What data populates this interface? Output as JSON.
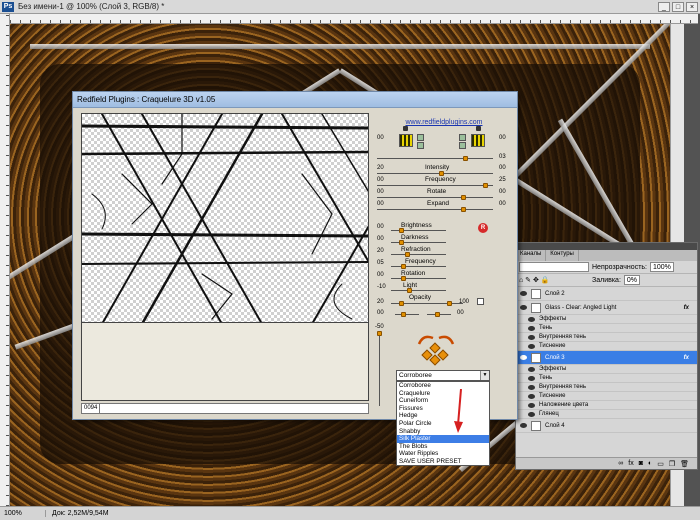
{
  "document": {
    "title": "Без имени-1 @ 100% (Слой 3, RGB/8) *",
    "app_icon": "Ps",
    "window_buttons": [
      "_",
      "□",
      "×"
    ]
  },
  "status": {
    "zoom": "100%",
    "doc_info": "Док: 2,52M/9,54M"
  },
  "plugin": {
    "title": "Redfield Plugins : Craquelure 3D  v1.05",
    "link": "www.redfieldplugins.com",
    "info_box": [
      "0094"
    ],
    "top_values": {
      "left": "00",
      "right": "00",
      "right2": "03"
    },
    "main_sliders": [
      {
        "label": "Intensity",
        "left": "20",
        "right": "00",
        "level": 0.55
      },
      {
        "label": "Frequency",
        "left": "00",
        "right": "25",
        "level": 0.95
      },
      {
        "label": "Rotate",
        "left": "00",
        "right": "00",
        "level": 0.75
      },
      {
        "label": "Expand",
        "left": "00",
        "right": "00",
        "level": 0.75
      }
    ],
    "light_sliders": [
      {
        "label": "Brightness",
        "value": "00"
      },
      {
        "label": "Darkness",
        "value": "00"
      },
      {
        "label": "Refraction",
        "value": "20"
      },
      {
        "label": "Frequency",
        "value": "05"
      },
      {
        "label": "Rotation",
        "value": "00"
      },
      {
        "label": "Light",
        "value": "-10"
      },
      {
        "label": "Opacity",
        "value": "20"
      }
    ],
    "opacity_right": "100",
    "bottom_row": {
      "left": "00",
      "right": "00"
    },
    "vertical_value": "-50",
    "reset_icon": "R",
    "preset": {
      "selected": "Corroboree",
      "options": [
        "Corroboree",
        "Craquelure",
        "Cuneiform",
        "Fissures",
        "Hedge",
        "Polar Circle",
        "Shabby",
        "Silk Plaster",
        "The Blobs",
        "Water Ripples",
        "SAVE USER PRESET"
      ],
      "highlighted": "Silk Plaster"
    }
  },
  "layers": {
    "tabs": [
      "Каналы",
      "Контуры"
    ],
    "opacity_label": "Непрозрачность:",
    "opacity_value": "100%",
    "fill_label": "Заливка:",
    "fill_value": "0%",
    "rows": [
      {
        "name": "Слой 2",
        "type": "layer"
      },
      {
        "name": "Glass - Clear: Angled Light",
        "type": "layer",
        "fx": "fx"
      },
      {
        "name": "Эффекты",
        "type": "group"
      },
      {
        "name": "Тень",
        "type": "effect"
      },
      {
        "name": "Внутренняя тень",
        "type": "effect"
      },
      {
        "name": "Тиснение",
        "type": "effect"
      },
      {
        "name": "Слой 3",
        "type": "layer",
        "selected": true,
        "fx": "fx"
      },
      {
        "name": "Эффекты",
        "type": "group"
      },
      {
        "name": "Тень",
        "type": "effect"
      },
      {
        "name": "Внутренняя тень",
        "type": "effect"
      },
      {
        "name": "Тиснение",
        "type": "effect"
      },
      {
        "name": "Наложение цвета",
        "type": "effect"
      },
      {
        "name": "Глянец",
        "type": "effect"
      },
      {
        "name": "Слой 4",
        "type": "layer"
      }
    ],
    "bottom_icons": [
      "link-icon",
      "fx-icon",
      "mask-icon",
      "adjustment-icon",
      "folder-icon",
      "new-layer-icon",
      "trash-icon"
    ]
  }
}
